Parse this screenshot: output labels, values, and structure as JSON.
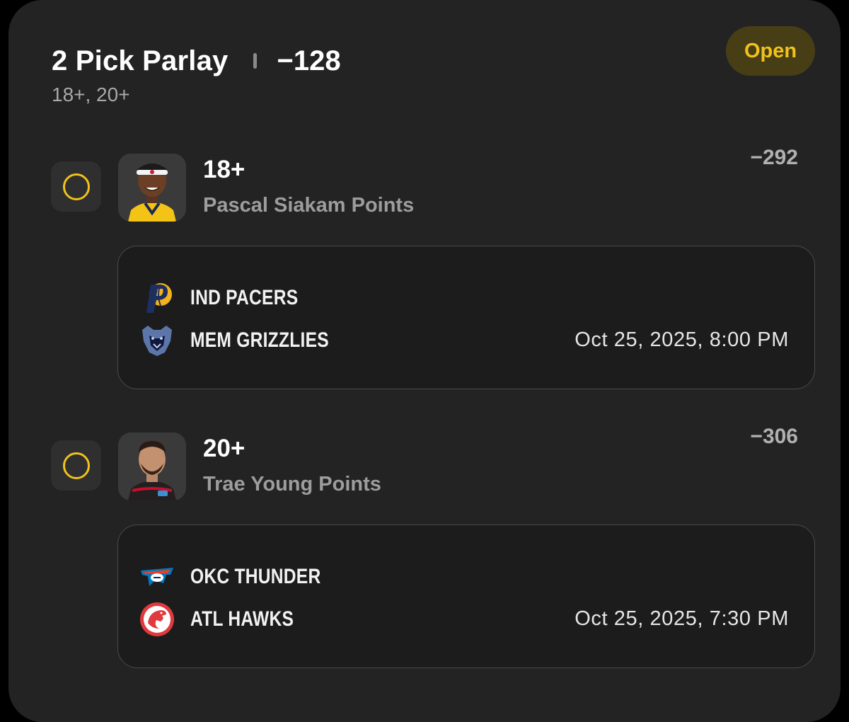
{
  "parlay": {
    "title": "2 Pick Parlay",
    "odds": "−128",
    "subtitle": "18+, 20+",
    "status": "Open"
  },
  "picks": [
    {
      "line": "18+",
      "description": "Pascal Siakam Points",
      "odds": "−292",
      "game": {
        "away_team": "IND PACERS",
        "away_logo": "pacers-logo-icon",
        "home_team": "MEM GRIZZLIES",
        "home_logo": "grizzlies-logo-icon",
        "datetime": "Oct 25, 2025, 8:00 PM"
      }
    },
    {
      "line": "20+",
      "description": "Trae Young Points",
      "odds": "−306",
      "game": {
        "away_team": "OKC THUNDER",
        "away_logo": "thunder-logo-icon",
        "home_team": "ATL HAWKS",
        "home_logo": "hawks-logo-icon",
        "datetime": "Oct 25, 2025, 7:30 PM"
      }
    }
  ],
  "colors": {
    "accent": "#f1c21b",
    "card_bg": "#232323",
    "game_box_bg": "#1c1c1c",
    "status_bg": "#473e16"
  }
}
